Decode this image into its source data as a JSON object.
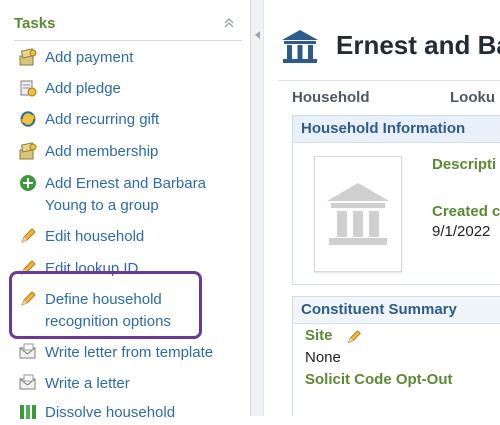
{
  "tasks": {
    "title": "Tasks",
    "items": [
      {
        "label": "Add payment",
        "icon": "payment-icon"
      },
      {
        "label": "Add pledge",
        "icon": "pledge-icon"
      },
      {
        "label": "Add recurring gift",
        "icon": "recurring-gift-icon"
      },
      {
        "label": "Add membership",
        "icon": "membership-icon"
      },
      {
        "label": "Add Ernest and Barbara Young to a group",
        "icon": "add-group-icon"
      },
      {
        "label": "Edit household",
        "icon": "pencil-icon"
      },
      {
        "label": "Edit lookup ID",
        "icon": "pencil-icon"
      },
      {
        "label": "Define household recognition options",
        "icon": "pencil-icon"
      },
      {
        "label": "Write letter from template",
        "icon": "envelope-icon"
      },
      {
        "label": "Write a letter",
        "icon": "envelope-icon"
      },
      {
        "label": "Dissolve household",
        "icon": "dissolve-icon"
      }
    ]
  },
  "page": {
    "title": "Ernest and Ba",
    "tabs": [
      "Household",
      "Looku"
    ]
  },
  "household_info": {
    "title": "Household Information",
    "description_label": "Descripti",
    "created_label": "Created c",
    "created_value": "9/1/2022"
  },
  "constituent_summary": {
    "title": "Constituent Summary",
    "site_label": "Site",
    "site_value": "None",
    "solicit_label": "Solicit Code Opt-Out"
  },
  "colors": {
    "accent_green": "#5a8a32",
    "link_blue": "#2d6aa8",
    "highlight_purple": "#6b3a96",
    "panel_title_blue": "#2d5b8c"
  }
}
